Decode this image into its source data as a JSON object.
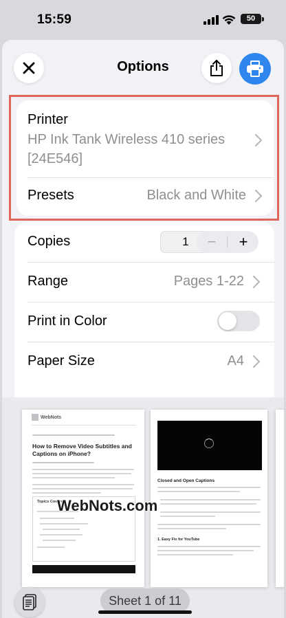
{
  "status_bar": {
    "time": "15:59",
    "battery": "50"
  },
  "header": {
    "title": "Options",
    "close_icon": "close-icon",
    "share_icon": "share-icon",
    "print_icon": "printer-icon",
    "accent_color": "#2f86ee"
  },
  "printer_card": {
    "printer_label": "Printer",
    "printer_value_line1": "HP Ink Tank Wireless 410 series",
    "printer_value_line2": "[24E546]",
    "presets_label": "Presets",
    "presets_value": "Black and White",
    "highlight_color": "#e0655b"
  },
  "settings": {
    "copies_label": "Copies",
    "copies_value": "1",
    "minus": "−",
    "plus": "+",
    "range_label": "Range",
    "range_value": "Pages 1-22",
    "color_label": "Print in Color",
    "color_enabled": false,
    "paper_label": "Paper Size",
    "paper_value": "A4"
  },
  "preview": {
    "page1_title": "How to Remove Video Subtitles and Captions on iPhone?",
    "page1_logo": "WebNots",
    "page1_toc_title": "Topics Covered",
    "page2_heading": "Closed and Open Captions",
    "page2_subheading": "1. Easy Fix for YouTube",
    "watermark": "WebNots.com",
    "sheet_indicator": "Sheet 1 of 11",
    "doc_icon": "document-icon"
  }
}
